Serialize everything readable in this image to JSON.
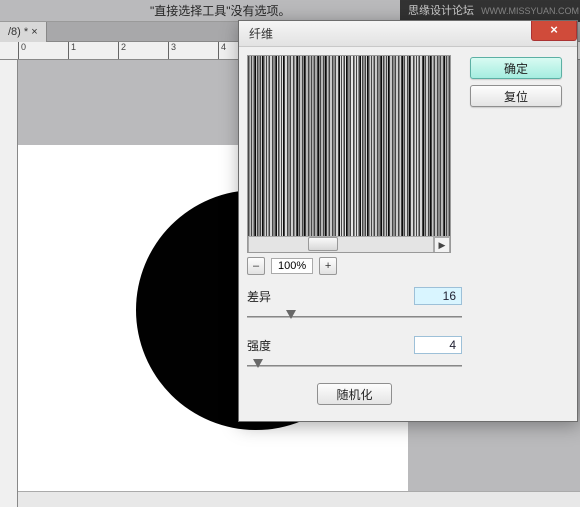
{
  "options_bar": {
    "text": "\"直接选择工具\"没有选项。"
  },
  "watermark": {
    "main": "思缘设计论坛",
    "sub": "WWW.MISSYUAN.COM"
  },
  "tab": {
    "label": "/8) * ×"
  },
  "dialog": {
    "title": "纤维",
    "close_label": "×",
    "ok_label": "确定",
    "reset_label": "复位",
    "randomize_label": "随机化",
    "zoom": {
      "value": "100%",
      "minus": "–",
      "plus": "+"
    },
    "params": {
      "variance": {
        "label": "差异",
        "value": "16"
      },
      "strength": {
        "label": "强度",
        "value": "4"
      }
    }
  }
}
